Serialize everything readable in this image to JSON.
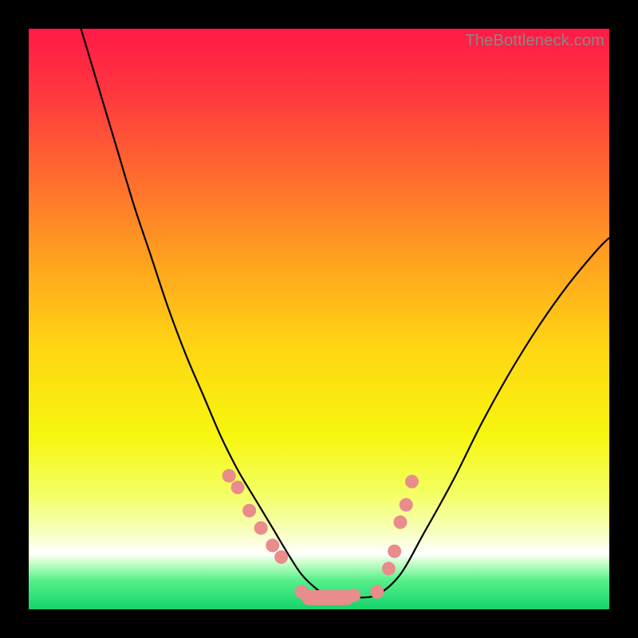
{
  "watermark": "TheBottleneck.com",
  "gradient": {
    "stops": [
      {
        "o": 0.0,
        "c": "#ff1a46"
      },
      {
        "o": 0.12,
        "c": "#ff3a3e"
      },
      {
        "o": 0.25,
        "c": "#ff6a2f"
      },
      {
        "o": 0.4,
        "c": "#ffa21f"
      },
      {
        "o": 0.55,
        "c": "#ffd613"
      },
      {
        "o": 0.7,
        "c": "#f6f60e"
      },
      {
        "o": 0.8,
        "c": "#f4ff62"
      },
      {
        "o": 0.86,
        "c": "#f6ffb4"
      },
      {
        "o": 0.905,
        "c": "#ffffff"
      },
      {
        "o": 0.92,
        "c": "#c8ffc8"
      },
      {
        "o": 0.95,
        "c": "#57f08a"
      },
      {
        "o": 1.0,
        "c": "#14d46a"
      }
    ]
  },
  "dot_color": "#e88c8c",
  "curve_color": "#000000",
  "chart_data": {
    "type": "line",
    "title": "",
    "xlabel": "",
    "ylabel": "",
    "xlim": [
      0,
      100
    ],
    "ylim": [
      0,
      100
    ],
    "grid": false,
    "series": [
      {
        "name": "bottleneck-curve",
        "x": [
          9,
          12,
          15,
          18,
          21,
          24,
          27,
          30,
          33,
          36,
          39,
          42,
          45,
          47,
          49,
          51,
          53,
          56,
          60,
          64,
          68,
          73,
          78,
          83,
          88,
          93,
          98,
          100
        ],
        "y": [
          100,
          90,
          80,
          70,
          61,
          52,
          44,
          37,
          30,
          24,
          19,
          14,
          9,
          6,
          4,
          2.5,
          2,
          2,
          2.5,
          6,
          13,
          22,
          32,
          41,
          49,
          56,
          62,
          64
        ]
      }
    ],
    "markers": {
      "name": "match-dots",
      "x": [
        34.5,
        36,
        38,
        40,
        42,
        43.5,
        47,
        49,
        51,
        53,
        55,
        56,
        60,
        62,
        63,
        64,
        65,
        66
      ],
      "y": [
        23,
        21,
        17,
        14,
        11,
        9,
        3,
        2.2,
        2,
        2,
        2.2,
        2.4,
        3,
        7,
        10,
        15,
        18,
        22
      ]
    },
    "bottom_bar": {
      "x0": 47,
      "x1": 56,
      "y": 2,
      "h": 2.6
    }
  }
}
